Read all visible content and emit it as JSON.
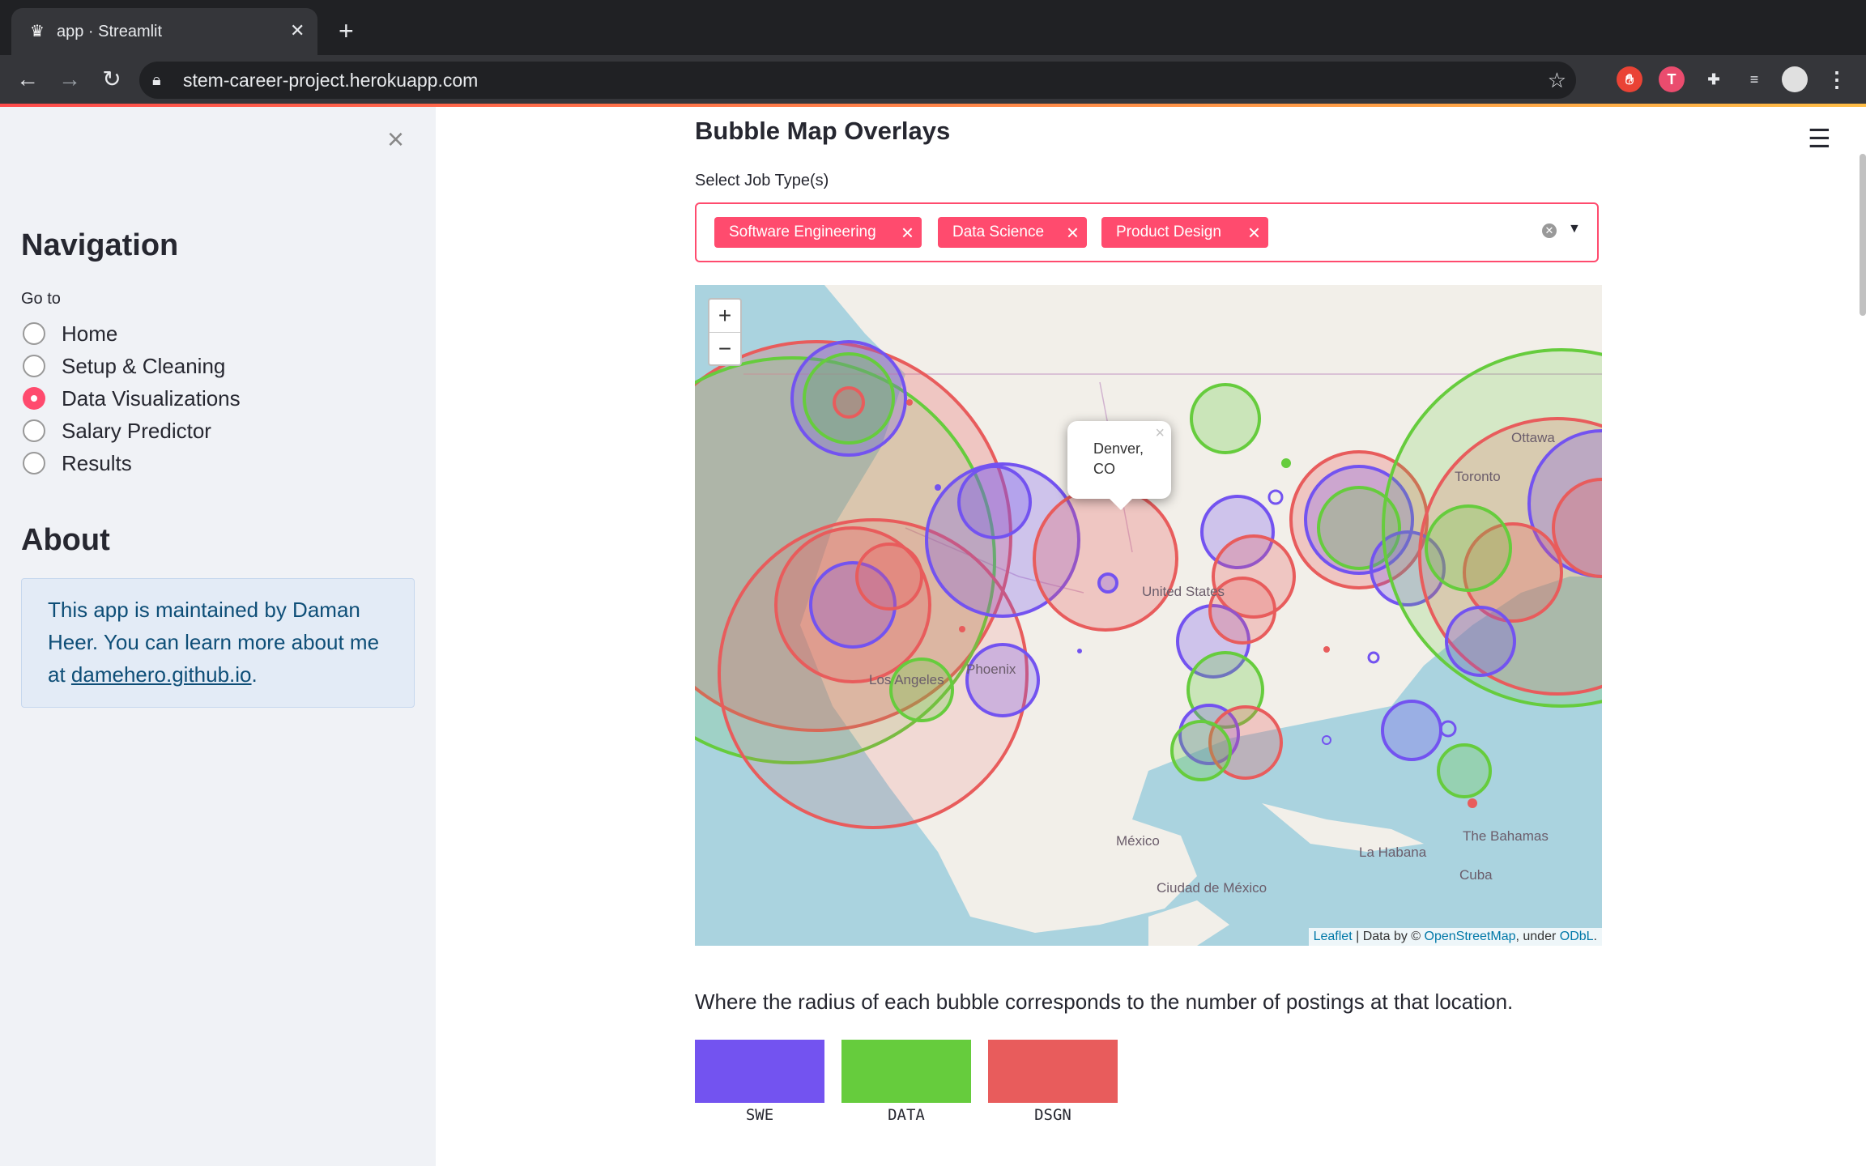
{
  "browser": {
    "tab_title": "app · Streamlit",
    "tab_close": "✕",
    "new_tab": "+",
    "url": "stem-career-project.herokuapp.com",
    "ext_badge": "T"
  },
  "sidebar": {
    "close": "×",
    "nav_heading": "Navigation",
    "goto_label": "Go to",
    "options": [
      {
        "label": "Home",
        "selected": false
      },
      {
        "label": "Setup & Cleaning",
        "selected": false
      },
      {
        "label": "Data Visualizations",
        "selected": true
      },
      {
        "label": "Salary Predictor",
        "selected": false
      },
      {
        "label": "Results",
        "selected": false
      }
    ],
    "about_heading": "About",
    "about_text_1": "This app is maintained by Daman Heer. You can learn more about me at ",
    "about_link": "damehero.github.io",
    "about_text_2": "."
  },
  "main": {
    "title": "Bubble Map Overlays",
    "select_label": "Select Job Type(s)",
    "chips": [
      {
        "label": "Software Engineering",
        "x": "×"
      },
      {
        "label": "Data Science",
        "x": "×"
      },
      {
        "label": "Product Design",
        "x": "×"
      }
    ],
    "map": {
      "zoom_in": "+",
      "zoom_out": "−",
      "popup_line1": "Denver,",
      "popup_line2": "CO",
      "popup_close": "×",
      "labels": [
        "Ottawa",
        "Toronto",
        "United States",
        "Los Angeles",
        "Phoenix",
        "México",
        "Ciudad de México",
        "La Habana",
        "The Bahamas",
        "Cuba"
      ],
      "attribution_leaflet": "Leaflet",
      "attribution_mid": " | Data by © ",
      "attribution_osm": "OpenStreetMap",
      "attribution_under": ", under ",
      "attribution_odbl": "ODbL",
      "attribution_end": "."
    },
    "caption": "Where the radius of each bubble corresponds to the number of postings at that location.",
    "legend": [
      {
        "label": "SWE",
        "color": "#7353f0"
      },
      {
        "label": "DATA",
        "color": "#66cc3d"
      },
      {
        "label": "DSGN",
        "color": "#e85c5c"
      }
    ]
  }
}
